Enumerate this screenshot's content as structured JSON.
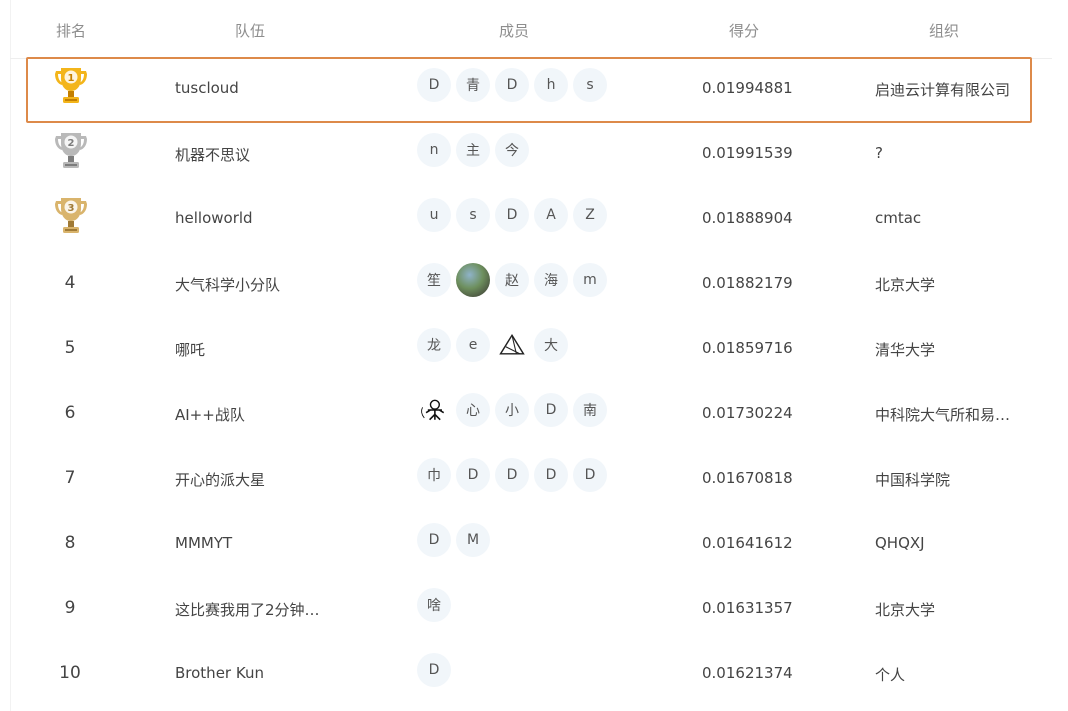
{
  "header": {
    "rank": "排名",
    "team": "队伍",
    "members": "成员",
    "score": "得分",
    "organization": "组织"
  },
  "rows": [
    {
      "rank": "1",
      "team": "tuscloud",
      "members": [
        "D",
        "青",
        "D",
        "h",
        "s"
      ],
      "score": "0.01994881",
      "org": "启迪云计算有限公司"
    },
    {
      "rank": "2",
      "team": "机器不思议",
      "members": [
        "n",
        "主",
        "今"
      ],
      "score": "0.01991539",
      "org": "?"
    },
    {
      "rank": "3",
      "team": "helloworld",
      "members": [
        "u",
        "s",
        "D",
        "A",
        "Z"
      ],
      "score": "0.01888904",
      "org": "cmtac"
    },
    {
      "rank": "4",
      "team": "大气科学小分队",
      "members": [
        "笙",
        "",
        "赵",
        "海",
        "m"
      ],
      "score": "0.01882179",
      "org": "北京大学"
    },
    {
      "rank": "5",
      "team": "哪吒",
      "members": [
        "龙",
        "e",
        "",
        "大"
      ],
      "score": "0.01859716",
      "org": "清华大学"
    },
    {
      "rank": "6",
      "team": "AI++战队",
      "members": [
        "",
        "心",
        "小",
        "D",
        "南"
      ],
      "score": "0.01730224",
      "org": "中科院大气所和易…"
    },
    {
      "rank": "7",
      "team": "开心的派大星",
      "members": [
        "巾",
        "D",
        "D",
        "D",
        "D"
      ],
      "score": "0.01670818",
      "org": "中国科学院"
    },
    {
      "rank": "8",
      "team": "MMMYT",
      "members": [
        "D",
        "M"
      ],
      "score": "0.01641612",
      "org": "QHQXJ"
    },
    {
      "rank": "9",
      "team": "这比赛我用了2分钟…",
      "members": [
        "啥"
      ],
      "score": "0.01631357",
      "org": "北京大学"
    },
    {
      "rank": "10",
      "team": "Brother Kun",
      "members": [
        "D"
      ],
      "score": "0.01621374",
      "org": "个人"
    }
  ],
  "colors": {
    "highlight_border": "#dd8a4a",
    "gold": "#f3b51b",
    "silver": "#b9b9b9",
    "bronze": "#d9b46c"
  }
}
